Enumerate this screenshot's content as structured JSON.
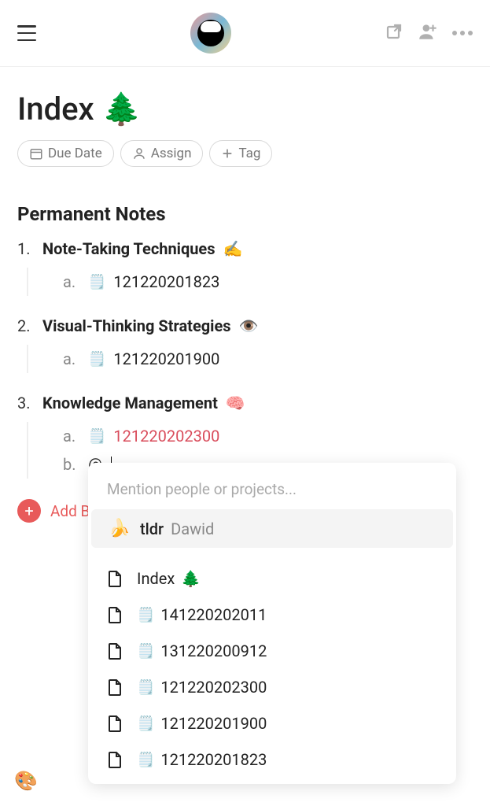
{
  "header": {
    "title": "Index",
    "title_emoji": "🌲"
  },
  "chips": {
    "due_date": "Due Date",
    "assign": "Assign",
    "tag": "Tag"
  },
  "section": {
    "title": "Permanent Notes"
  },
  "notes": [
    {
      "num": "1.",
      "label": "Note-Taking Techniques",
      "emoji": "✍️",
      "subs": [
        {
          "letter": "a.",
          "emoji": "🗒️",
          "value": "121220201823",
          "link": false
        }
      ]
    },
    {
      "num": "2.",
      "label": "Visual-Thinking Strategies",
      "emoji": "👁️",
      "subs": [
        {
          "letter": "a.",
          "emoji": "🗒️",
          "value": "121220201900",
          "link": false
        }
      ]
    },
    {
      "num": "3.",
      "label": "Knowledge Management",
      "emoji": "🧠",
      "subs": [
        {
          "letter": "a.",
          "emoji": "🗒️",
          "value": "121220202300",
          "link": true
        },
        {
          "letter": "b.",
          "raw": "@"
        }
      ]
    }
  ],
  "add_block": {
    "label": "Add B"
  },
  "popup": {
    "header": "Mention people or projects...",
    "selected": {
      "emoji": "🍌",
      "title": "tldr",
      "subtitle": "Dawid"
    },
    "projects": [
      {
        "emoji_prefix": "",
        "title": "Index",
        "emoji_suffix": "🌲"
      },
      {
        "emoji_prefix": "🗒️",
        "title": "141220202011"
      },
      {
        "emoji_prefix": "🗒️",
        "title": "131220200912"
      },
      {
        "emoji_prefix": "🗒️",
        "title": "121220202300"
      },
      {
        "emoji_prefix": "🗒️",
        "title": "121220201900"
      },
      {
        "emoji_prefix": "🗒️",
        "title": "121220201823"
      }
    ]
  }
}
